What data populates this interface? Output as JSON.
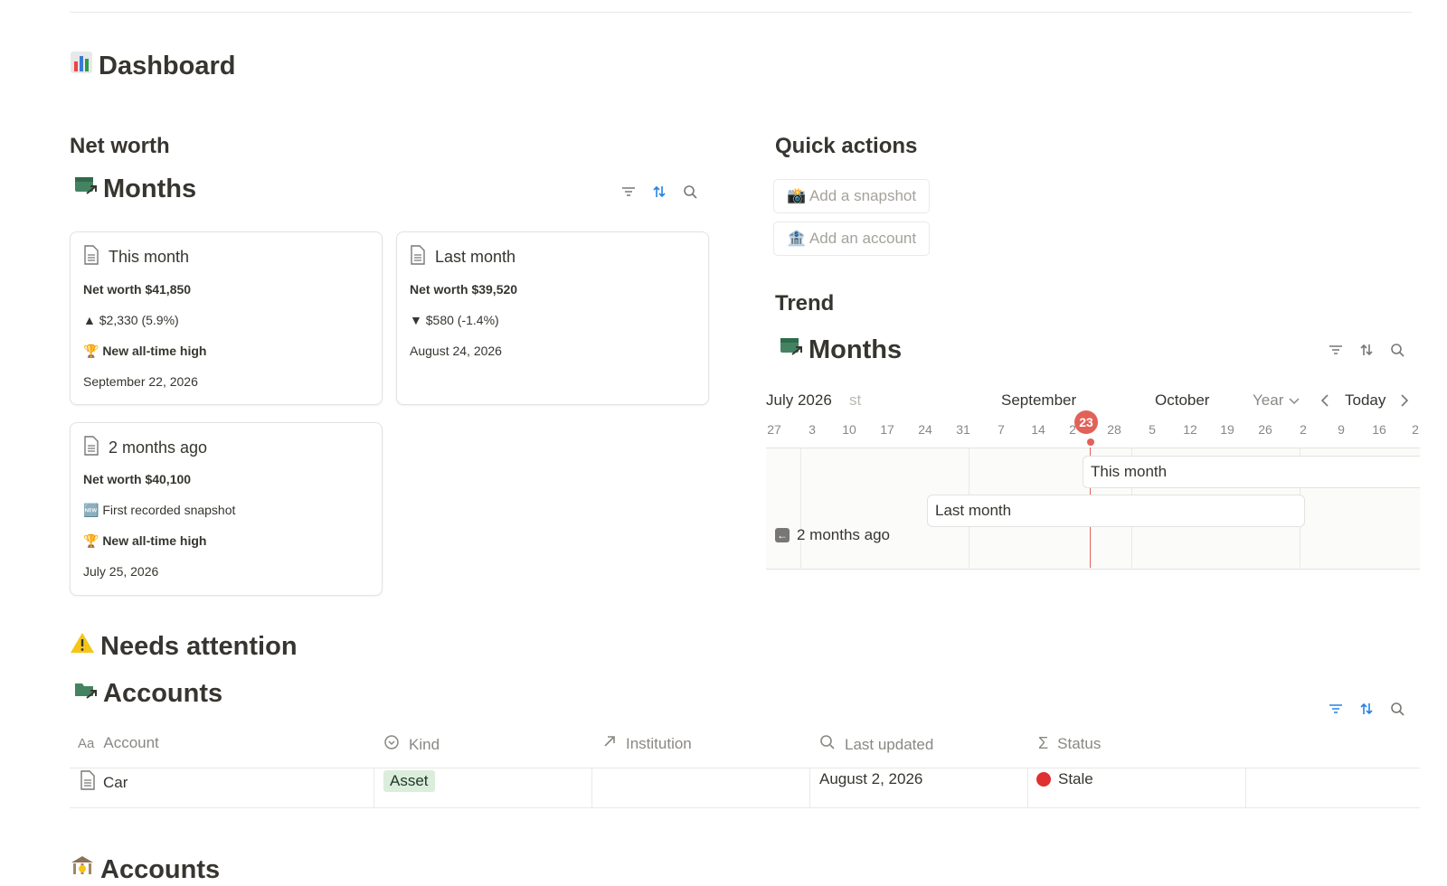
{
  "page": {
    "title": "Dashboard"
  },
  "net_worth": {
    "heading": "Net worth",
    "db_title": "Months",
    "cards": [
      {
        "title": "This month",
        "net_worth": "Net worth $41,850",
        "change": "▲ $2,330 (5.9%)",
        "badge": "🏆 New all-time high",
        "date": "September 22, 2026"
      },
      {
        "title": "Last month",
        "net_worth": "Net worth $39,520",
        "change": "▼ $580 (-1.4%)",
        "date": "August 24, 2026"
      },
      {
        "title": "2 months ago",
        "net_worth": "Net worth $40,100",
        "note": "🆕 First recorded snapshot",
        "badge": "🏆 New all-time high",
        "date": "July 25, 2026"
      }
    ]
  },
  "quick_actions": {
    "heading": "Quick actions",
    "buttons": [
      "📸 Add a snapshot",
      "🏦 Add an account"
    ]
  },
  "trend": {
    "heading": "Trend",
    "db_title": "Months",
    "months": [
      "July 2026",
      "st",
      "September",
      "October"
    ],
    "range_select": "Year",
    "today_label": "Today",
    "ticks": [
      "27",
      "3",
      "10",
      "17",
      "24",
      "31",
      "7",
      "14",
      "2",
      "23",
      "28",
      "5",
      "12",
      "19",
      "26",
      "2",
      "9",
      "16",
      "2"
    ],
    "items": [
      "This month",
      "Last month",
      "2 months ago"
    ]
  },
  "attention": {
    "heading": "Needs attention",
    "db_title": "Accounts",
    "columns": [
      "Account",
      "Kind",
      "Institution",
      "Last updated",
      "Status"
    ],
    "rows": [
      {
        "account": "Car",
        "kind": "Asset",
        "institution": "",
        "last_updated": "August 2, 2026",
        "status": "Stale"
      }
    ]
  },
  "accounts_section": {
    "heading": "Accounts"
  },
  "colors": {
    "accent_blue": "#2383e2",
    "green_text": "#448361",
    "today_red": "#e16259"
  }
}
